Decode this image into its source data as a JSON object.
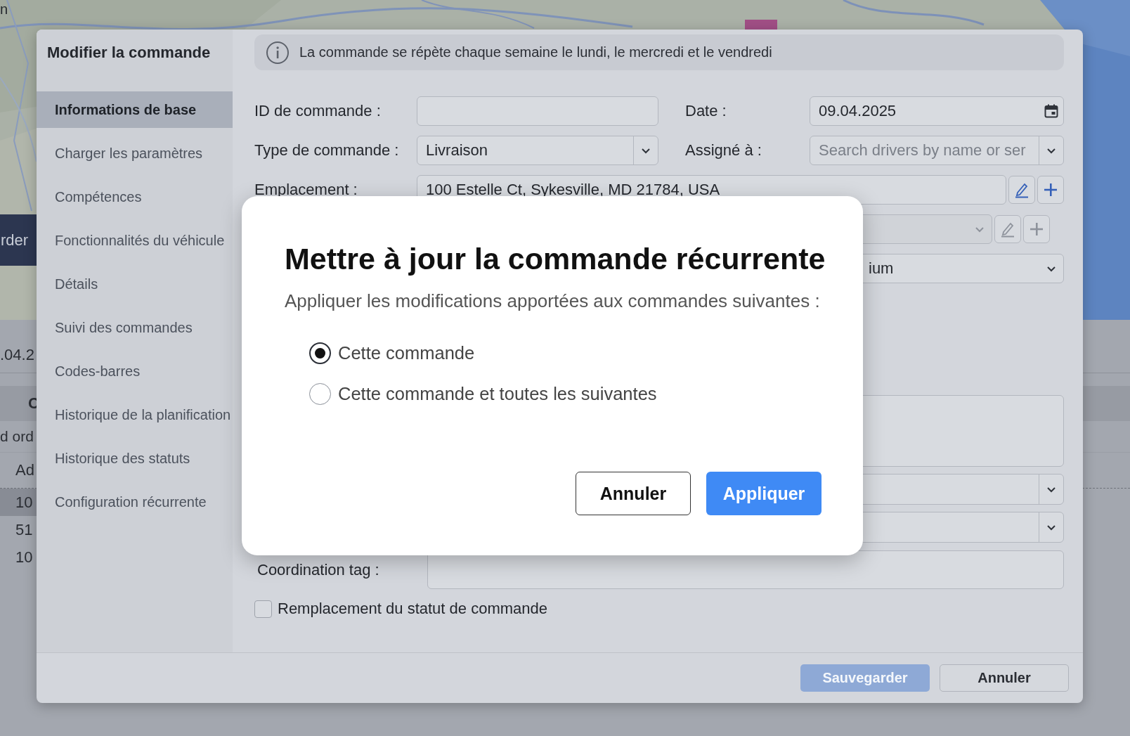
{
  "background": {
    "corner_text": "n",
    "banner_text": "rder",
    "date_text": ".04.2",
    "table": {
      "heading": "C",
      "caption": "d ord",
      "column": "Ad",
      "rows": [
        {
          "text": "10",
          "selected": true
        },
        {
          "text": "51",
          "selected": false
        },
        {
          "text": "10",
          "selected": false
        }
      ]
    }
  },
  "edit_dialog": {
    "title": "Modifier la commande",
    "nav": [
      {
        "label": "Informations de base",
        "selected": true
      },
      {
        "label": "Charger les paramètres",
        "selected": false
      },
      {
        "label": "Compétences",
        "selected": false
      },
      {
        "label": "Fonctionnalités du véhicule",
        "selected": false
      },
      {
        "label": "Détails",
        "selected": false
      },
      {
        "label": "Suivi des commandes",
        "selected": false
      },
      {
        "label": "Codes-barres",
        "selected": false
      },
      {
        "label": "Historique de la planification",
        "selected": false
      },
      {
        "label": "Historique des statuts",
        "selected": false
      },
      {
        "label": "Configuration récurrente",
        "selected": false
      }
    ],
    "banner": "La commande se répète chaque semaine le lundi, le mercredi et le vendredi",
    "fields": {
      "order_id": {
        "label": "ID de commande :"
      },
      "date": {
        "label": "Date :",
        "value": "09.04.2025"
      },
      "order_type": {
        "label": "Type de commande :",
        "value": "Livraison"
      },
      "assigned_to": {
        "label": "Assigné à :",
        "placeholder": "Search drivers by name or ser"
      },
      "location": {
        "label": "Emplacement :",
        "value": "100 Estelle Ct, Sykesville, MD 21784, USA",
        "disabled": false
      },
      "row_4": {
        "disabled": true
      },
      "row_5": {
        "value": "ium"
      },
      "coordination_tag": {
        "label": "Coordination tag :"
      },
      "status_override": {
        "label": "Remplacement du statut de commande",
        "checked": false
      }
    },
    "buttons": [
      {
        "label": "Sauvegarder",
        "kind": "primary",
        "disabled": true
      },
      {
        "label": "Annuler",
        "kind": "secondary",
        "disabled": false
      }
    ]
  },
  "modal": {
    "title": "Mettre à jour la commande récurrente",
    "subtitle": "Appliquer les modifications apportées aux commandes suivantes :",
    "options": [
      {
        "label": "Cette commande",
        "selected": true
      },
      {
        "label": "Cette commande et toutes les suivantes",
        "selected": false
      }
    ],
    "buttons": [
      {
        "label": "Annuler",
        "kind": "secondary"
      },
      {
        "label": "Appliquer",
        "kind": "primary"
      }
    ]
  }
}
